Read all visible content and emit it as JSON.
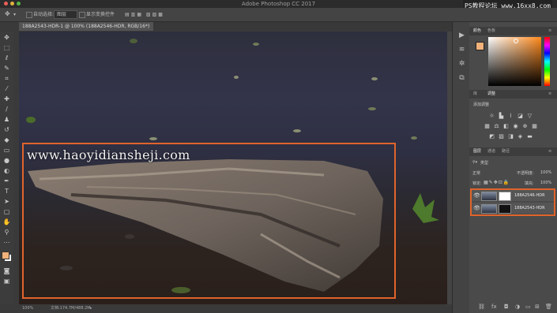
{
  "app": {
    "title": "Adobe Photoshop CC 2017",
    "watermark_top": "PS教程论坛 www.16xx8.com",
    "canvas_watermark": "www.haoyidiansheji.com"
  },
  "options_bar": {
    "auto_select_label": "自动选择:",
    "auto_select_value": "图层",
    "show_transform_label": "显示变换控件"
  },
  "document": {
    "tab_title": "188A2543-HDR-1 @ 100% (188A2546-HDR, RGB/16*) *",
    "zoom": "100%",
    "doc_info": "文档:174.7M/488.2M"
  },
  "panels": {
    "color_tabs": [
      "颜色",
      "色板"
    ],
    "adjust_tabs": [
      "库",
      "调整"
    ],
    "adjust_title": "添加调整",
    "layer_tabs": [
      "图层",
      "通道",
      "路径"
    ],
    "kind_filter": "类型",
    "blend_mode": "正常",
    "opacity_label": "不透明度:",
    "opacity_value": "100%",
    "lock_label": "锁定:",
    "fill_label": "填充:",
    "fill_value": "100%",
    "layers": [
      {
        "name": "188A2546-HDR"
      },
      {
        "name": "188A2543-HDR"
      }
    ]
  },
  "colors": {
    "selection_highlight": "#e0642c",
    "foreground": "#f0b27a",
    "background": "#ffffff"
  },
  "icons": {
    "toolbar": [
      "move-icon",
      "marquee-icon",
      "lasso-icon",
      "quick-select-icon",
      "crop-icon",
      "eyedropper-icon",
      "healing-icon",
      "brush-icon",
      "stamp-icon",
      "history-brush-icon",
      "eraser-icon",
      "gradient-icon",
      "blur-icon",
      "dodge-icon",
      "pen-icon",
      "type-icon",
      "path-select-icon",
      "shape-icon",
      "hand-icon",
      "zoom-icon"
    ]
  }
}
